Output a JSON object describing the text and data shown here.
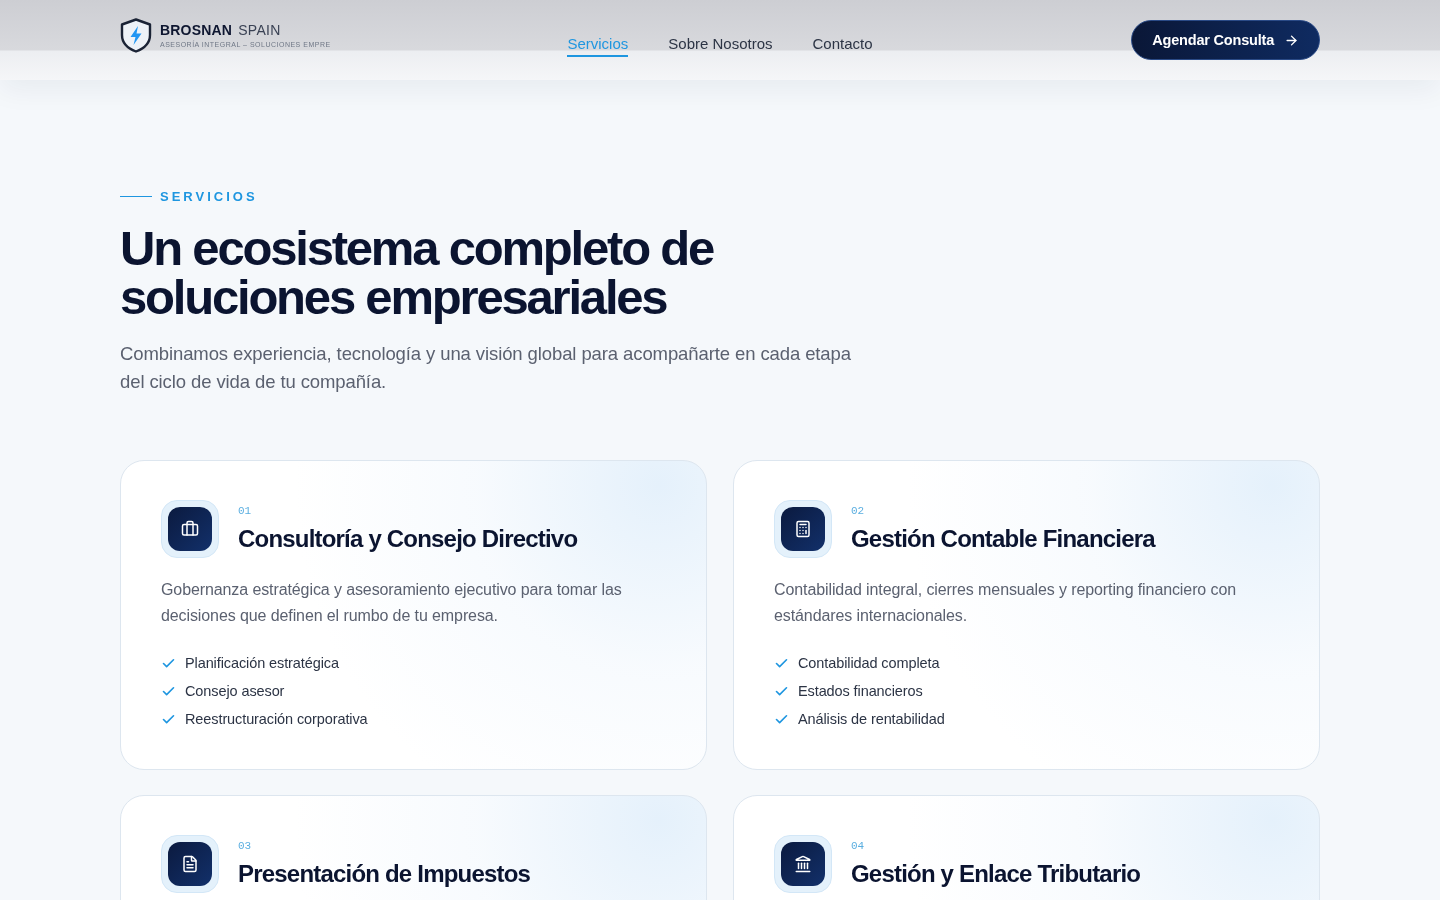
{
  "header": {
    "logo": {
      "name": "BROSNAN",
      "suffix": "SPAIN",
      "tagline": "ASESORÍA INTEGRAL – SOLUCIONES EMPRE"
    },
    "nav": [
      {
        "label": "Servicios",
        "selected": true
      },
      {
        "label": "Sobre Nosotros",
        "selected": false
      },
      {
        "label": "Contacto",
        "selected": false
      }
    ],
    "cta": {
      "label": "Agendar Consulta"
    }
  },
  "section": {
    "eyebrow": "SERVICIOS",
    "title": "Un ecosistema completo de soluciones empresariales",
    "subtitle": "Combinamos experiencia, tecnología y una visión global para acompañarte en cada etapa del ciclo de vida de tu compañía."
  },
  "cards": [
    {
      "number": "01",
      "title": "Consultoría y Consejo Directivo",
      "description": "Gobernanza estratégica y asesoramiento ejecutivo para tomar las decisiones que definen el rumbo de tu empresa.",
      "features": [
        "Planificación estratégica",
        "Consejo asesor",
        "Reestructuración corporativa"
      ]
    },
    {
      "number": "02",
      "title": "Gestión Contable Financiera",
      "description": "Contabilidad integral, cierres mensuales y reporting financiero con estándares internacionales.",
      "features": [
        "Contabilidad completa",
        "Estados financieros",
        "Análisis de rentabilidad"
      ]
    },
    {
      "number": "03",
      "title": "Presentación de Impuestos"
    },
    {
      "number": "04",
      "title": "Gestión y Enlace Tributario"
    }
  ]
}
